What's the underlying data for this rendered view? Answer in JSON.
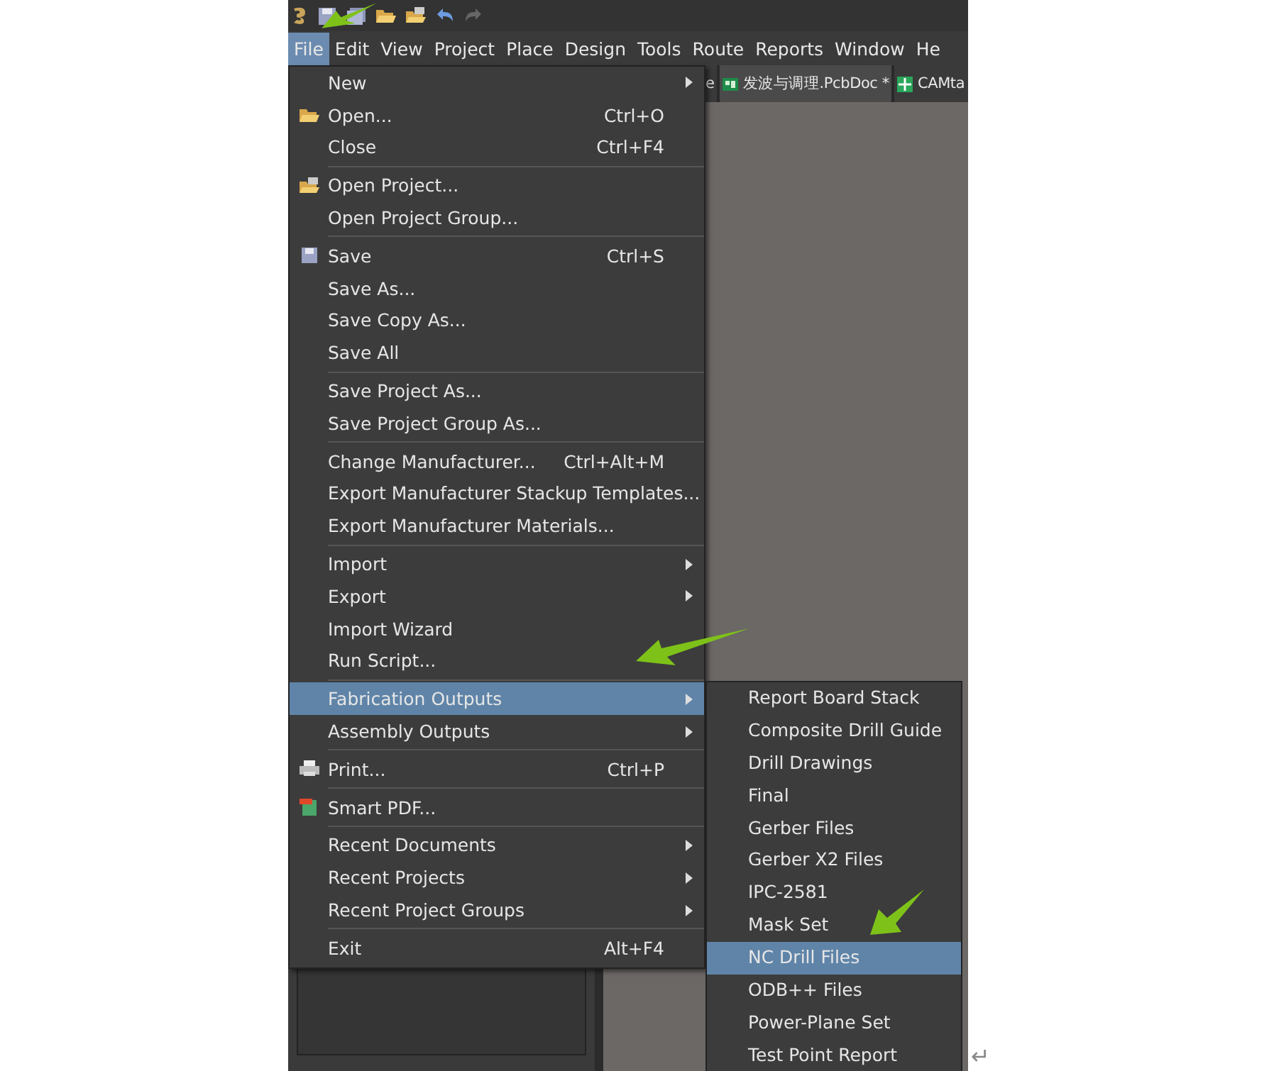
{
  "menubar": [
    {
      "label": "File",
      "selected": true
    },
    {
      "label": "Edit",
      "selected": false
    },
    {
      "label": "View",
      "selected": false
    },
    {
      "label": "Project",
      "selected": false
    },
    {
      "label": "Place",
      "selected": false
    },
    {
      "label": "Design",
      "selected": false
    },
    {
      "label": "Tools",
      "selected": false
    },
    {
      "label": "Route",
      "selected": false
    },
    {
      "label": "Reports",
      "selected": false
    },
    {
      "label": "Window",
      "selected": false
    },
    {
      "label": "He",
      "selected": false
    }
  ],
  "tabs": [
    {
      "label": "e",
      "selected": false
    },
    {
      "label": "发波与调理.PcbDoc *",
      "selected": true
    },
    {
      "label": "CAMta",
      "selected": false
    }
  ],
  "file_menu": [
    {
      "kind": "item",
      "label": "New",
      "submenu": true,
      "selected": false
    },
    {
      "kind": "item",
      "label": "Open...",
      "shortcut": "Ctrl+O",
      "selected": false
    },
    {
      "kind": "item",
      "label": "Close",
      "shortcut": "Ctrl+F4",
      "selected": false
    },
    {
      "kind": "separator"
    },
    {
      "kind": "item",
      "label": "Open Project...",
      "selected": false
    },
    {
      "kind": "item",
      "label": "Open Project Group...",
      "selected": false
    },
    {
      "kind": "separator"
    },
    {
      "kind": "item",
      "label": "Save",
      "shortcut": "Ctrl+S",
      "selected": false
    },
    {
      "kind": "item",
      "label": "Save As...",
      "selected": false
    },
    {
      "kind": "item",
      "label": "Save Copy As...",
      "selected": false
    },
    {
      "kind": "item",
      "label": "Save All",
      "selected": false
    },
    {
      "kind": "separator"
    },
    {
      "kind": "item",
      "label": "Save Project As...",
      "selected": false
    },
    {
      "kind": "item",
      "label": "Save Project Group As...",
      "selected": false
    },
    {
      "kind": "separator"
    },
    {
      "kind": "item",
      "label": "Change Manufacturer...",
      "shortcut": "Ctrl+Alt+M",
      "selected": false
    },
    {
      "kind": "item",
      "label": "Export Manufacturer Stackup Templates...",
      "selected": false
    },
    {
      "kind": "item",
      "label": "Export Manufacturer Materials...",
      "selected": false
    },
    {
      "kind": "separator"
    },
    {
      "kind": "item",
      "label": "Import",
      "submenu": true,
      "selected": false
    },
    {
      "kind": "item",
      "label": "Export",
      "submenu": true,
      "selected": false
    },
    {
      "kind": "item",
      "label": "Import Wizard",
      "selected": false
    },
    {
      "kind": "item",
      "label": "Run Script...",
      "selected": false
    },
    {
      "kind": "separator"
    },
    {
      "kind": "item",
      "label": "Fabrication Outputs",
      "submenu": true,
      "selected": true
    },
    {
      "kind": "item",
      "label": "Assembly Outputs",
      "submenu": true,
      "selected": false
    },
    {
      "kind": "separator"
    },
    {
      "kind": "item",
      "label": "Print...",
      "shortcut": "Ctrl+P",
      "selected": false
    },
    {
      "kind": "separator"
    },
    {
      "kind": "item",
      "label": "Smart PDF...",
      "selected": false
    },
    {
      "kind": "separator"
    },
    {
      "kind": "item",
      "label": "Recent Documents",
      "submenu": true,
      "selected": false
    },
    {
      "kind": "item",
      "label": "Recent Projects",
      "submenu": true,
      "selected": false
    },
    {
      "kind": "item",
      "label": "Recent Project Groups",
      "submenu": true,
      "selected": false
    },
    {
      "kind": "separator"
    },
    {
      "kind": "item",
      "label": "Exit",
      "shortcut": "Alt+F4",
      "selected": false
    }
  ],
  "fabrication_submenu": [
    {
      "label": "Report Board Stack",
      "selected": false
    },
    {
      "label": "Composite Drill Guide",
      "selected": false
    },
    {
      "label": "Drill Drawings",
      "selected": false
    },
    {
      "label": "Final",
      "selected": false
    },
    {
      "label": "Gerber Files",
      "selected": false
    },
    {
      "label": "Gerber X2 Files",
      "selected": false
    },
    {
      "label": "IPC-2581",
      "selected": false
    },
    {
      "label": "Mask Set",
      "selected": false
    },
    {
      "label": "NC Drill Files",
      "selected": true
    },
    {
      "label": "ODB++ Files",
      "selected": false
    },
    {
      "label": "Power-Plane Set",
      "selected": false
    },
    {
      "label": "Test Point Report",
      "selected": false
    }
  ],
  "return_mark": "↵"
}
